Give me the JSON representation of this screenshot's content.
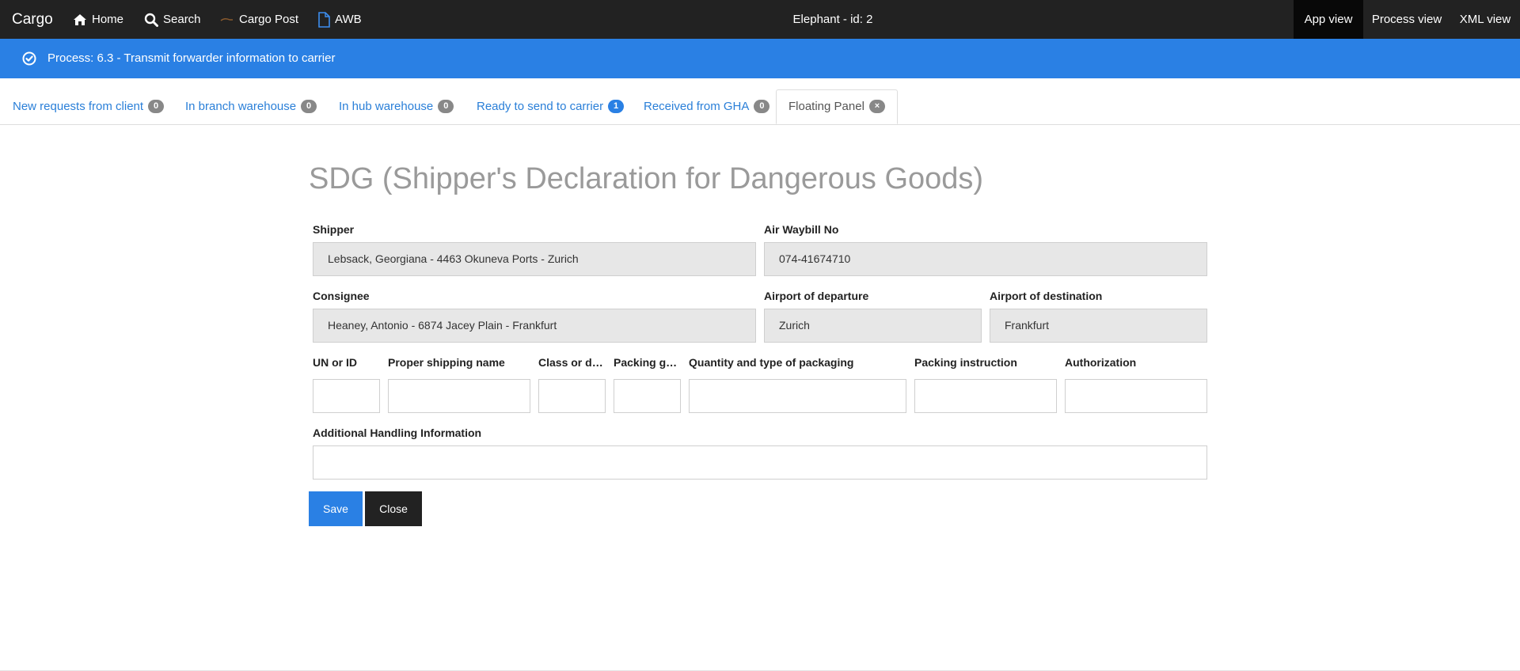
{
  "navbar": {
    "brand": "Cargo",
    "links": [
      {
        "label": "Home",
        "icon": "home-icon"
      },
      {
        "label": "Search",
        "icon": "search-icon"
      },
      {
        "label": "Cargo Post",
        "icon": "cargo-post-icon"
      },
      {
        "label": "AWB",
        "icon": "document-icon"
      }
    ],
    "center_title": "Elephant - id: 2",
    "views": [
      {
        "label": "App view",
        "active": true
      },
      {
        "label": "Process view",
        "active": false
      },
      {
        "label": "XML view",
        "active": false
      }
    ]
  },
  "process": {
    "text": "Process: 6.3 - Transmit forwarder information to carrier",
    "icon": "check-circle-icon"
  },
  "tabs": [
    {
      "label": "New requests from client",
      "count": "0"
    },
    {
      "label": "In branch warehouse",
      "count": "0"
    },
    {
      "label": "In hub warehouse",
      "count": "0"
    },
    {
      "label": "Ready to send to carrier",
      "count": "1"
    },
    {
      "label": "Received from GHA",
      "count": "0"
    },
    {
      "label": "Floating Panel",
      "count": "×",
      "active": true
    }
  ],
  "form": {
    "title": "SDG (Shipper's Declaration for Dangerous Goods)",
    "shipper_label": "Shipper",
    "shipper_value": "Lebsack, Georgiana - 4463 Okuneva Ports - Zurich",
    "awb_label": "Air Waybill No",
    "awb_value": "074-41674710",
    "consignee_label": "Consignee",
    "consignee_value": "Heaney, Antonio - 6874 Jacey Plain - Frankfurt",
    "departure_label": "Airport of departure",
    "departure_value": "Zurich",
    "destination_label": "Airport of destination",
    "destination_value": "Frankfurt",
    "un_label": "UN or ID",
    "un_value": "",
    "psn_label": "Proper shipping name",
    "psn_value": "",
    "class_label": "Class or division",
    "class_value": "",
    "packing_group_label": "Packing group",
    "packing_group_value": "",
    "qty_label": "Quantity and type of packaging",
    "qty_value": "",
    "packing_instruction_label": "Packing instruction",
    "packing_instruction_value": "",
    "authorization_label": "Authorization",
    "authorization_value": "",
    "ahi_label": "Additional Handling Information",
    "ahi_value": "",
    "save_label": "Save",
    "close_label": "Close"
  },
  "colors": {
    "navbar": "#222222",
    "accent": "#2a80e4",
    "link": "#2a7fd8",
    "readonly_field": "#e7e7e7"
  }
}
